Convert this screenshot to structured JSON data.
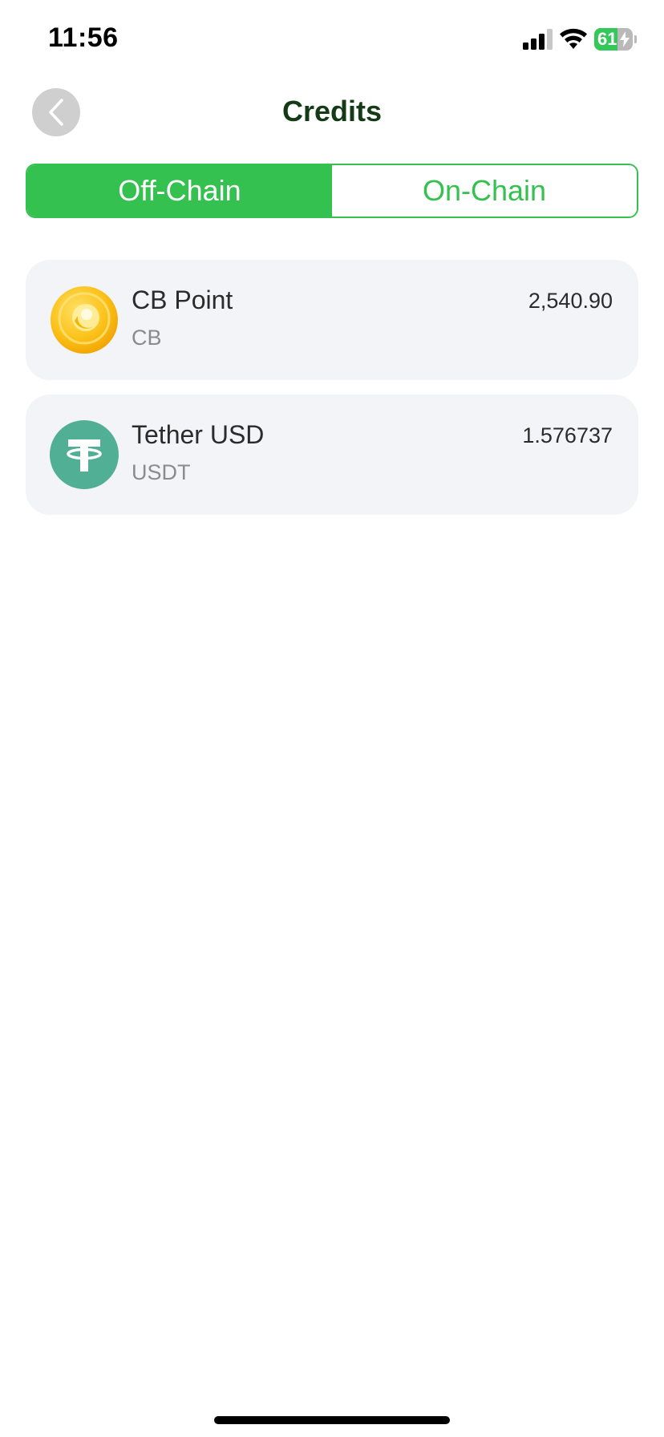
{
  "status_bar": {
    "time": "11:56",
    "battery_percent": "61",
    "battery_level": 0.61,
    "icons": [
      "cellular-signal-icon",
      "wifi-icon",
      "battery-charging-icon"
    ]
  },
  "header": {
    "title": "Credits",
    "back_icon": "chevron-left-icon"
  },
  "tabs": [
    {
      "label": "Off-Chain",
      "active": true
    },
    {
      "label": "On-Chain",
      "active": false
    }
  ],
  "assets": [
    {
      "name": "CB Point",
      "symbol": "CB",
      "balance": "2,540.90",
      "icon": "cb-coin-icon"
    },
    {
      "name": "Tether USD",
      "symbol": "USDT",
      "balance": "1.576737",
      "icon": "tether-icon"
    }
  ],
  "colors": {
    "accent": "#34c14f",
    "title": "#143a16",
    "card_bg": "#f3f4f7",
    "tether": "#50af95",
    "coin": "#f7b500"
  }
}
